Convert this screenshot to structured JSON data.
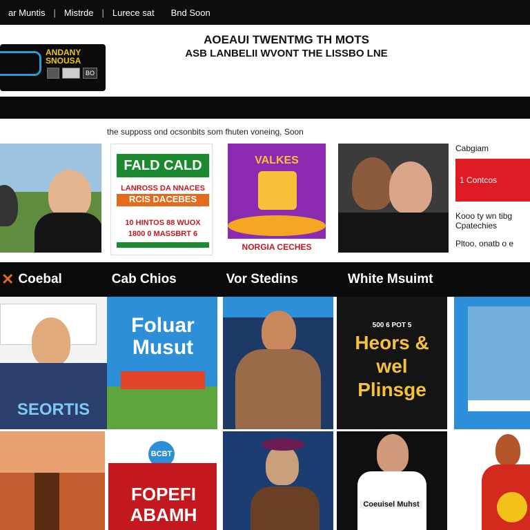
{
  "topnav": {
    "items": [
      "ar Muntis",
      "Mistrde",
      "Lurece sat",
      "Bnd Soon"
    ],
    "separators": [
      "|",
      "|"
    ]
  },
  "logo": {
    "text": "ANDANY SNOUSA",
    "pills": [
      "",
      "",
      "BO"
    ]
  },
  "headline": {
    "line1": "AOEAUI TWENTMG TH MOTS",
    "line2": "ASB LANBELII WVONT THE LISSBO LNE"
  },
  "subtitle": "the supposs ond ocsonbits som fhuten voneing, Soon",
  "featured": {
    "tile2_title": "FALD CALD",
    "tile2_lines": [
      "LANROSS DA NNACES",
      "RCIS DACEBES",
      "10 HINTOS 88 WUOX",
      "1800 0 MASSBRT 6"
    ],
    "tile3_title": "VALKES",
    "tile3_caption": "NORGIA CECHES"
  },
  "sidepanel": {
    "label": "Cabgiam",
    "cta": "1 Contcos",
    "line1": "Kooo ty wn tibg",
    "line2": "Cpatechies",
    "line3": "Pltoo, onatb o e"
  },
  "categories": [
    "Coebal",
    "Cab Chios",
    "Vor Stedins",
    "White Msuimt"
  ],
  "cards_row1": {
    "c1_title": "SEORTIS",
    "c2_title": "Foluar Musut",
    "c4_title": "Heors & wel Plinsge",
    "c4_top": "500 6 POT 5"
  },
  "cards_row2": {
    "c2_top": "BCBT",
    "c2_title": "FOPEFI ABAMH",
    "c4_caption": "Coeuisel Muhst"
  },
  "colors": {
    "accent_red": "#e01b24",
    "brand_blue": "#2d9bd3",
    "nav_bg": "#0d0d0d"
  }
}
